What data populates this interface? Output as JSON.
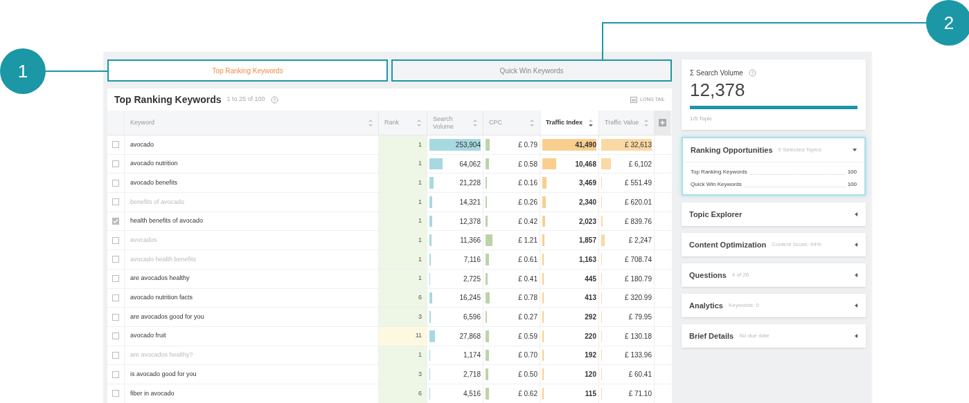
{
  "callouts": [
    {
      "number": "1"
    },
    {
      "number": "2"
    }
  ],
  "tabs": [
    {
      "label": "Top Ranking Keywords",
      "selected": true
    },
    {
      "label": "Quick Win Keywords",
      "selected": false
    }
  ],
  "table_title": "Top Ranking Keywords",
  "table_count": "1 to 25 of 100",
  "long_tail": "LONG TAIL",
  "columns": [
    {
      "label": "Keyword",
      "sorted": false
    },
    {
      "label": "Rank",
      "sorted": false
    },
    {
      "label": "Search Volume",
      "sorted": false
    },
    {
      "label": "CPC",
      "sorted": false
    },
    {
      "label": "Traffic Index",
      "sorted": true
    },
    {
      "label": "Traffic Value",
      "sorted": false
    }
  ],
  "rows": [
    {
      "keyword": "avocado",
      "checked": false,
      "muted": false,
      "rank": {
        "text": "1",
        "color": "#eef6e6"
      },
      "search_volume": {
        "text": "253,904",
        "level": 1
      },
      "cpc": {
        "text": "£ 0.79",
        "level": 0.08
      },
      "traffic_index": {
        "text": "41,490",
        "level": 1
      },
      "traffic_value": {
        "text": "£ 32,613",
        "level": 1
      }
    },
    {
      "keyword": "avocado nutrition",
      "checked": false,
      "muted": false,
      "rank": {
        "text": "1",
        "color": "#eef6e6"
      },
      "search_volume": {
        "text": "64,062",
        "level": 0.25
      },
      "cpc": {
        "text": "£ 0.58",
        "level": 0.06
      },
      "traffic_index": {
        "text": "10,468",
        "level": 0.25
      },
      "traffic_value": {
        "text": "£ 6,102",
        "level": 0.19
      }
    },
    {
      "keyword": "avocado benefits",
      "checked": false,
      "muted": false,
      "rank": {
        "text": "1",
        "color": "#eef6e6"
      },
      "search_volume": {
        "text": "21,228",
        "level": 0.08
      },
      "cpc": {
        "text": "£ 0.16",
        "level": 0.02
      },
      "traffic_index": {
        "text": "3,469",
        "level": 0.08
      },
      "traffic_value": {
        "text": "£ 551.49",
        "level": 0.02
      }
    },
    {
      "keyword": "benefits of avocado",
      "checked": false,
      "muted": true,
      "rank": {
        "text": "1",
        "color": "#eef6e6"
      },
      "search_volume": {
        "text": "14,321",
        "level": 0.06
      },
      "cpc": {
        "text": "£ 0.26",
        "level": 0.02
      },
      "traffic_index": {
        "text": "2,340",
        "level": 0.06
      },
      "traffic_value": {
        "text": "£ 620.01",
        "level": 0.02
      }
    },
    {
      "keyword": "health benefits of avocado",
      "checked": true,
      "muted": false,
      "rank": {
        "text": "1",
        "color": "#eef6e6"
      },
      "search_volume": {
        "text": "12,378",
        "level": 0.05
      },
      "cpc": {
        "text": "£ 0.42",
        "level": 0.04
      },
      "traffic_index": {
        "text": "2,023",
        "level": 0.05
      },
      "traffic_value": {
        "text": "£ 839.76",
        "level": 0.03
      }
    },
    {
      "keyword": "avocados",
      "checked": false,
      "muted": true,
      "rank": {
        "text": "1",
        "color": "#eef6e6"
      },
      "search_volume": {
        "text": "11,366",
        "level": 0.04
      },
      "cpc": {
        "text": "£ 1.21",
        "level": 0.13
      },
      "traffic_index": {
        "text": "1,857",
        "level": 0.04
      },
      "traffic_value": {
        "text": "£ 2,247",
        "level": 0.07
      }
    },
    {
      "keyword": "avocado health benefits",
      "checked": false,
      "muted": true,
      "rank": {
        "text": "1",
        "color": "#eef6e6"
      },
      "search_volume": {
        "text": "7,116",
        "level": 0.03
      },
      "cpc": {
        "text": "£ 0.61",
        "level": 0.06
      },
      "traffic_index": {
        "text": "1,163",
        "level": 0.03
      },
      "traffic_value": {
        "text": "£ 708.74",
        "level": 0.02
      }
    },
    {
      "keyword": "are avocados healthy",
      "checked": false,
      "muted": false,
      "rank": {
        "text": "1",
        "color": "#eef6e6"
      },
      "search_volume": {
        "text": "2,725",
        "level": 0.02
      },
      "cpc": {
        "text": "£ 0.41",
        "level": 0.04
      },
      "traffic_index": {
        "text": "445",
        "level": 0.02
      },
      "traffic_value": {
        "text": "£ 180.79",
        "level": 0.02
      }
    },
    {
      "keyword": "avocado nutrition facts",
      "checked": false,
      "muted": false,
      "rank": {
        "text": "6",
        "color": "#eef6e6"
      },
      "search_volume": {
        "text": "16,245",
        "level": 0.06
      },
      "cpc": {
        "text": "£ 0.78",
        "level": 0.08
      },
      "traffic_index": {
        "text": "413",
        "level": 0.02
      },
      "traffic_value": {
        "text": "£ 320.99",
        "level": 0.02
      }
    },
    {
      "keyword": "are avocados good for you",
      "checked": false,
      "muted": false,
      "rank": {
        "text": "3",
        "color": "#eef6e6"
      },
      "search_volume": {
        "text": "6,596",
        "level": 0.03
      },
      "cpc": {
        "text": "£ 0.27",
        "level": 0.02
      },
      "traffic_index": {
        "text": "292",
        "level": 0.02
      },
      "traffic_value": {
        "text": "£ 79.95",
        "level": 0.02
      }
    },
    {
      "keyword": "avocado fruit",
      "checked": false,
      "muted": false,
      "rank": {
        "text": "11",
        "color": "#fdf9e1"
      },
      "search_volume": {
        "text": "27,868",
        "level": 0.11
      },
      "cpc": {
        "text": "£ 0.59",
        "level": 0.06
      },
      "traffic_index": {
        "text": "220",
        "level": 0.02
      },
      "traffic_value": {
        "text": "£ 130.18",
        "level": 0.02
      }
    },
    {
      "keyword": "are avocados healthy?",
      "checked": false,
      "muted": true,
      "rank": {
        "text": "1",
        "color": "#eef6e6"
      },
      "search_volume": {
        "text": "1,174",
        "level": 0.02
      },
      "cpc": {
        "text": "£ 0.70",
        "level": 0.07
      },
      "traffic_index": {
        "text": "192",
        "level": 0.02
      },
      "traffic_value": {
        "text": "£ 133.96",
        "level": 0.02
      }
    },
    {
      "keyword": "is avocado good for you",
      "checked": false,
      "muted": false,
      "rank": {
        "text": "3",
        "color": "#eef6e6"
      },
      "search_volume": {
        "text": "2,718",
        "level": 0.02
      },
      "cpc": {
        "text": "£ 0.50",
        "level": 0.05
      },
      "traffic_index": {
        "text": "120",
        "level": 0.02
      },
      "traffic_value": {
        "text": "£ 60.41",
        "level": 0.02
      }
    },
    {
      "keyword": "fiber in avocado",
      "checked": false,
      "muted": false,
      "rank": {
        "text": "6",
        "color": "#eef6e6"
      },
      "search_volume": {
        "text": "4,516",
        "level": 0.02
      },
      "cpc": {
        "text": "£ 0.62",
        "level": 0.06
      },
      "traffic_index": {
        "text": "115",
        "level": 0.02
      },
      "traffic_value": {
        "text": "£ 71.10",
        "level": 0.02
      }
    }
  ],
  "summary": {
    "title": "Σ Search Volume",
    "value": "12,378",
    "level": 1,
    "caption": "1/5 Topic"
  },
  "sections": [
    {
      "title": "Ranking Opportunities",
      "subtitle": "0 Selected Topics",
      "expanded": true,
      "items": [
        {
          "label": "Top Ranking Keywords",
          "value": "100"
        },
        {
          "label": "Quick Win Keywords",
          "value": "100"
        }
      ]
    },
    {
      "title": "Topic Explorer",
      "expanded": false
    },
    {
      "title": "Content Optimization",
      "subtitle": "Content Score: 94%",
      "expanded": false
    },
    {
      "title": "Questions",
      "subtitle": "4 of 26",
      "expanded": false
    },
    {
      "title": "Analytics",
      "subtitle": "Keywords: 0",
      "expanded": false
    },
    {
      "title": "Brief Details",
      "subtitle": "No due date",
      "expanded": false
    }
  ]
}
